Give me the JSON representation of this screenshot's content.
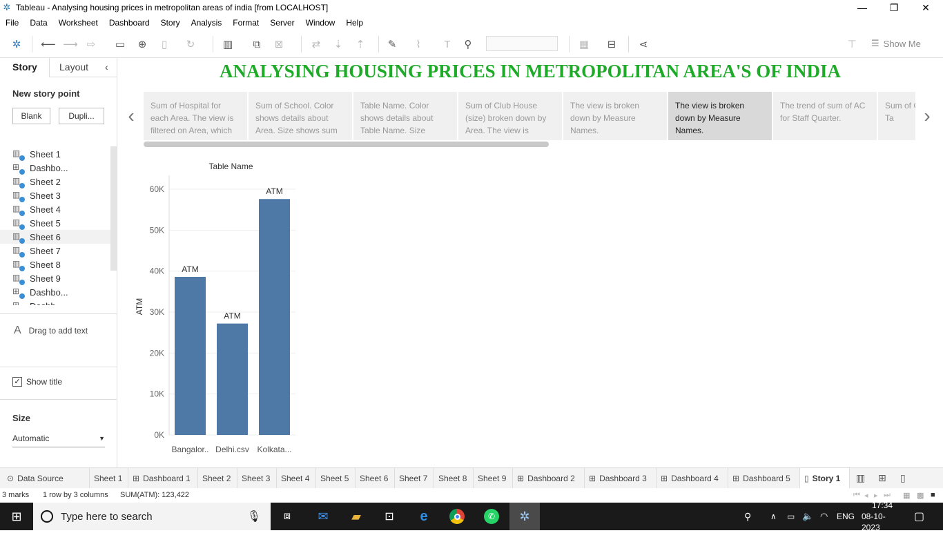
{
  "window": {
    "title": "Tableau - Analysing housing prices in metropolitan areas of india [from LOCALHOST]",
    "controls": [
      "minimize",
      "maximize",
      "close"
    ]
  },
  "menu": [
    "File",
    "Data",
    "Worksheet",
    "Dashboard",
    "Story",
    "Analysis",
    "Format",
    "Server",
    "Window",
    "Help"
  ],
  "toolbar": {
    "show_me_label": "Show Me"
  },
  "sidebar": {
    "tab_story": "Story",
    "tab_layout": "Layout",
    "new_story_point": "New story point",
    "blank_button": "Blank",
    "duplicate_button": "Dupli...",
    "sheets": [
      {
        "label": "Sheet 1",
        "kind": "sheet"
      },
      {
        "label": "Dashbo...",
        "kind": "dashboard"
      },
      {
        "label": "Sheet 2",
        "kind": "sheet"
      },
      {
        "label": "Sheet 3",
        "kind": "sheet"
      },
      {
        "label": "Sheet 4",
        "kind": "sheet"
      },
      {
        "label": "Sheet 5",
        "kind": "sheet"
      },
      {
        "label": "Sheet 6",
        "kind": "sheet"
      },
      {
        "label": "Sheet 7",
        "kind": "sheet"
      },
      {
        "label": "Sheet 8",
        "kind": "sheet"
      },
      {
        "label": "Sheet 9",
        "kind": "sheet"
      },
      {
        "label": "Dashbo...",
        "kind": "dashboard"
      },
      {
        "label": "Dashb...",
        "kind": "dashboard"
      }
    ],
    "drag_text": "Drag to add text",
    "show_title": "Show title",
    "size_label": "Size",
    "size_value": "Automatic"
  },
  "story": {
    "title": "ANALYSING HOUSING PRICES IN METROPOLITAN AREA'S OF INDIA",
    "title_color": "#1faa2a",
    "points": [
      "Sum of Hospital for each Area. The view is filtered on Area, which",
      "Sum of School.  Color shows details about Area.  Size shows sum",
      "Table Name.  Color shows details about Table Name.  Size",
      "Sum of Club House (size) broken down by Area. The view is",
      "The view is broken down by Measure Names.",
      "The view is broken down by Measure Names.",
      "The trend of sum of AC for Staff Quarter.",
      "Sum of Color sh about Ta"
    ],
    "active_point": 5
  },
  "chart_data": {
    "type": "bar",
    "title": "Table Name",
    "ylabel": "ATM",
    "categories": [
      "Bangalor..",
      "Delhi.csv",
      "Kolkata..."
    ],
    "values": [
      38600,
      27200,
      57600
    ],
    "data_labels": [
      "ATM",
      "ATM",
      "ATM"
    ],
    "ylim": [
      0,
      60000
    ],
    "yticks": [
      "0K",
      "10K",
      "20K",
      "30K",
      "40K",
      "50K",
      "60K"
    ],
    "bar_color": "#4e79a7",
    "grid": true
  },
  "bottom_tabs": {
    "data_source": "Data Source",
    "tabs": [
      {
        "label": "Sheet 1",
        "kind": "sheet"
      },
      {
        "label": "Dashboard 1",
        "kind": "dashboard"
      },
      {
        "label": "Sheet 2",
        "kind": "sheet"
      },
      {
        "label": "Sheet 3",
        "kind": "sheet"
      },
      {
        "label": "Sheet 4",
        "kind": "sheet"
      },
      {
        "label": "Sheet 5",
        "kind": "sheet"
      },
      {
        "label": "Sheet 6",
        "kind": "sheet"
      },
      {
        "label": "Sheet 7",
        "kind": "sheet"
      },
      {
        "label": "Sheet 8",
        "kind": "sheet"
      },
      {
        "label": "Sheet 9",
        "kind": "sheet"
      },
      {
        "label": "Dashboard 2",
        "kind": "dashboard"
      },
      {
        "label": "Dashboard 3",
        "kind": "dashboard"
      },
      {
        "label": "Dashboard 4",
        "kind": "dashboard"
      },
      {
        "label": "Dashboard 5",
        "kind": "dashboard"
      },
      {
        "label": "Story 1",
        "kind": "story"
      }
    ]
  },
  "status": {
    "marks": "3 marks",
    "rows": "1 row by 3 columns",
    "sum": "SUM(ATM): 123,422"
  },
  "taskbar": {
    "search_placeholder": "Type here to search",
    "lang": "ENG",
    "time": "17:34",
    "date": "08-10-2023"
  }
}
